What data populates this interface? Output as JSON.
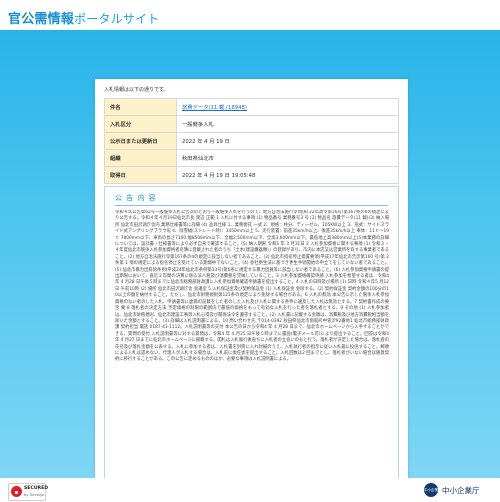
{
  "header": {
    "title_main": "官公需情報",
    "title_sub": "ポータルサイト"
  },
  "panel": {
    "intro": "入札情報は以下の通りです。",
    "rows": [
      {
        "label": "件名",
        "value": "旅費データ(11 載 (18948)",
        "is_link": true
      },
      {
        "label": "入札区分",
        "value": "一般競争入札"
      },
      {
        "label": "公示日または更新日",
        "value": "2022 年 4 月 19 日"
      },
      {
        "label": "組織",
        "value": "秋田県仙北市"
      },
      {
        "label": "取得日",
        "value": "2022 年 4 月 19 日 19:05:48"
      }
    ],
    "notice": {
      "title": "公 告 内 容",
      "body": "令和４年公告第62号一般競争入札公告次のとおり一般競争入札を行うので、地方自治法施行令(昭和 22年政令第16号)第167条の6の規定により公告する。令和４年４月19日仙北市長 渡辺 正範 1 入札に付する事項 (1) 物品番号 業務番号3 号 (2) 物品名 旅費データ(11 載)(3) 納入場所 仙北市田沢湖庁舎内 業務仕様書等に詳細 (4) 品目仕様 1、業務委託 一式 2、規格：共分、ディーゼル、105KW以上 3、形式：サイドスライド式アングリングブラウ形 4、除雪幅(ストレート時)：3450mm以上 5、走行装置：前進35km/h以上、後進35km/h以上 車体：11ｔ～19ｔ 7800mm以下、車両の長さ7100 幅8500mm以下、全幅2,500mm以下、全高3,600mm以下。最低地上高380mm以上(5)本業務の詳細については、設計書・仕様書等により必ず自身で確認すること。(5) 納入期限 令和5 年 3 月31日 2 入札参加資格に関する事項 (1) 令和３・４年度仙北市競争入札参加資格者名簿に登載された者のうち「土木(建設機器類)」の登録があり、市内に本店又は営業所を有する事業者であること。(2) 地方自治法施行令第167条の4の規定に該当しない者であること。(3) 仙北市指名停止措置要領(平成17年仙北市告示第160 号)第 2 条第 1 項の規定による指名停止を受けている期間中でないこと。(4) 会社更生法に基づき更生手続開始の申立てをしていない者であること。(5) 仙北市暴力団排除条例(平成24年仙北市条例第33号)第6条に規定する暴力団員等に該当しない者であること。(6) 入札参加資格申請書の提出期限において、直近２年間の決算に係る法人税及び消費税を完納していること。3 入札参加資格確認申請 入札参加を希望する者は、令和4 年 4 月28 日午後５時までに仙北市総務部財政課に入札参加資格確認申請書を提出すること。4 入札の日時及び場所 (1) 日時 令和４年5 月12日 午前10時 (2) 場所 仙北市田沢湖庁舎 会議室 5 入札保証金及び契約保証金 (1) 入札保証金 免除する。(2) 契約保証金 契約金額の100分の10以上の額を納付すること。ただし、仙北市財務規則第121条の規定により免除する場合がある。6 入札の無効 本公告に示した競争入札参加資格のない者のした入札、申請書等に虚偽の記載をした者のした入札及び入札に関する条件に違反した入札は無効とする。7 契約書作成の要否 要 8 落札者の決定方法 予定価格の制限の範囲内で最低の価格をもって有効な入札を行った者を落札者とする。9 その他 (1) 入札参加者は、仙北市財務規則、仙北市建設工事等入札心得及び関係法令を遵守すること。(2) 入札書に記載する金額は、消費税及び地方消費税相当額を除いた金額とすること。(3) 詳細は入札説明書による。10 問い合わせ先 〒014-0392 秋田県仙北市角館町中菅沢92番地1 仙北市総務部財政課 契約担当 電話 0187-43-1112。入札説明書等の交付 本公告の日から令和4 年 4 月28 日まで、仙北市ホームページから入手することができる。質問の受付 入札説明書等に対する質問は、令和4 年 4 月25 日午後５時までに書面(電子メール可)により提出すること。回答は令和4 年 4 月27 日までに仙北市ホームページに掲載する。開札は入札執行後直ちに入札者の立会いのもと行う。落札者が決定した場合は、落札者の氏名及び落札金額を公表する。入札に参加する者は、入札書を封筒に入れ封緘のうえ、入札執行者の指示に従い入札箱に投函すること。郵便による入札は認めない。代理人が入札する場合は、入札前に委任状を提出すること。入札回数は2 回までとし、落札者がいない場合は随意契約に移行することがある。この公告に定めるもののほか、必要な事項は入札説明書による。"
    }
  },
  "footer": {
    "secured_line1": "SECURED",
    "secured_line2": "by Sectigo",
    "partner_badge": "中小企業庁",
    "agency": "中小企業庁"
  }
}
